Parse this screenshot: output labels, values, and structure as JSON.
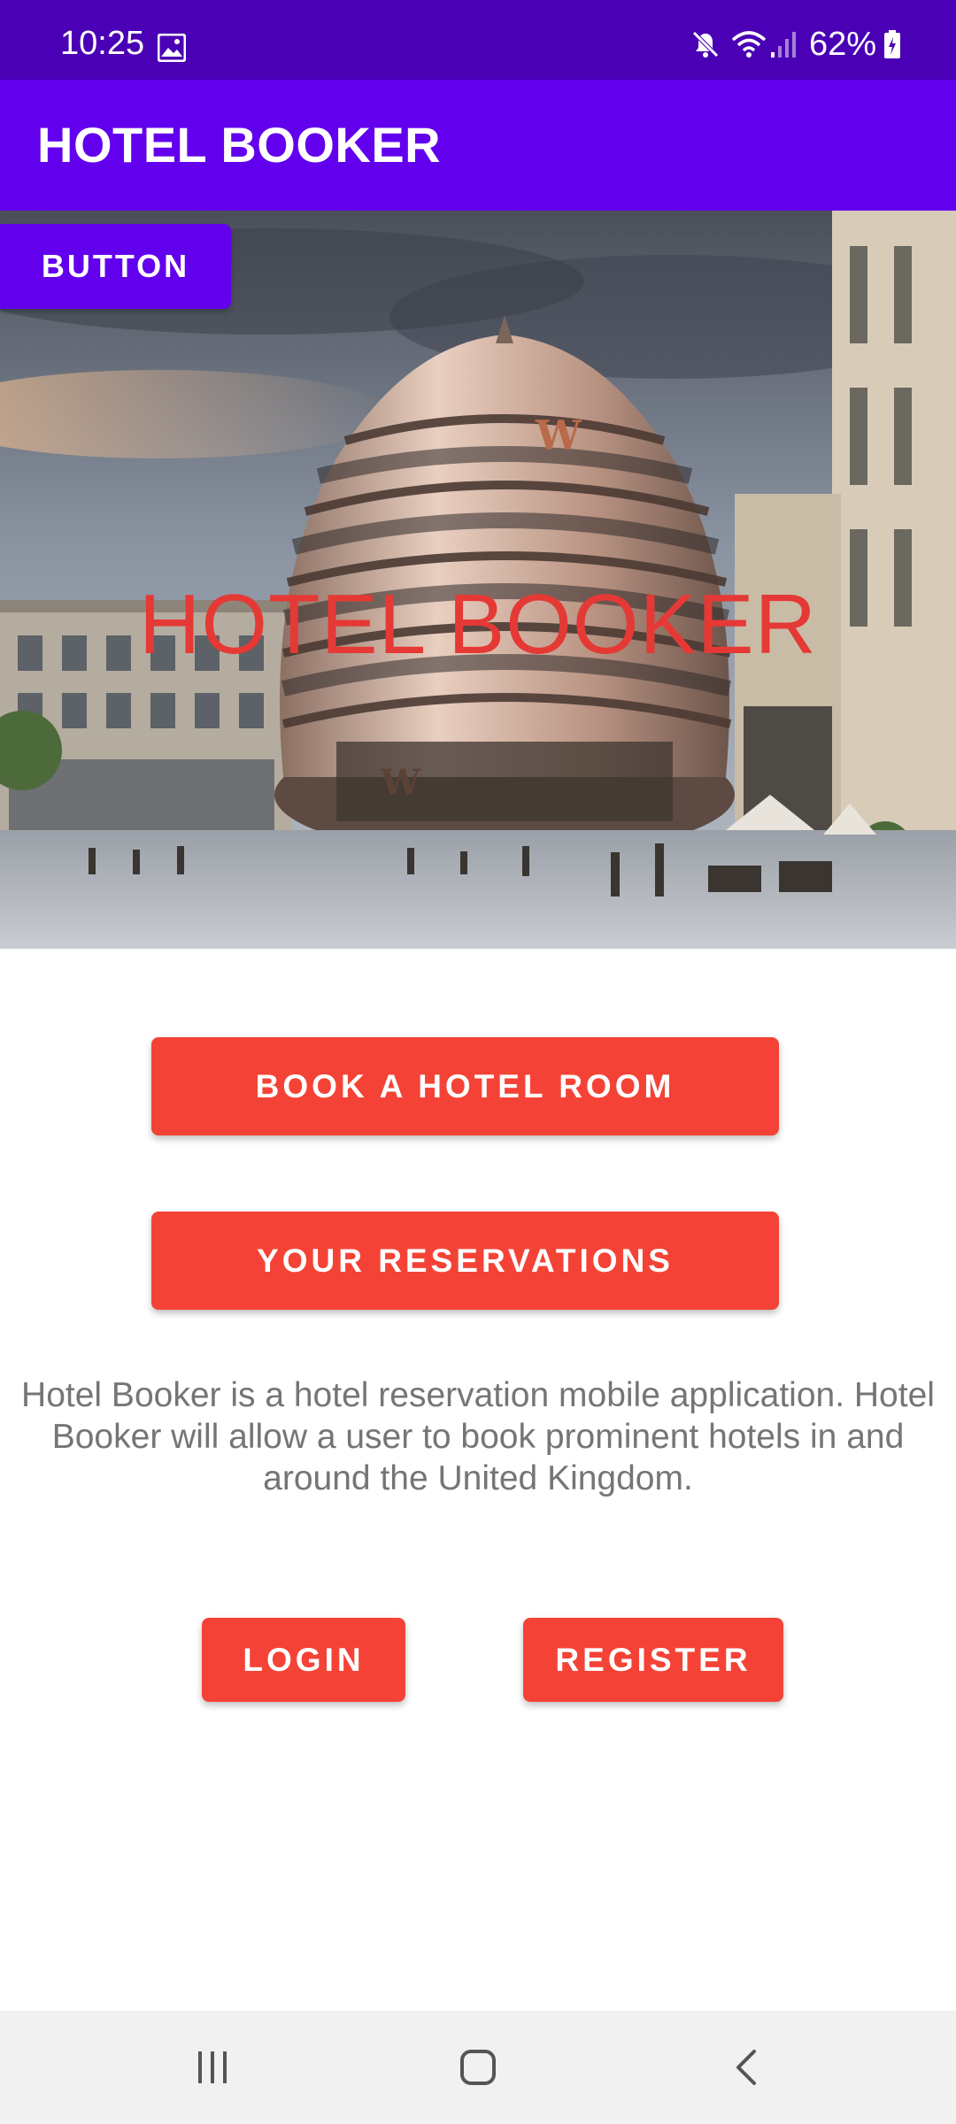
{
  "status_bar": {
    "time": "10:25",
    "battery": "62%",
    "icons": [
      "gallery-icon",
      "mute-icon",
      "wifi-icon",
      "signal-icon",
      "battery-icon"
    ]
  },
  "app_bar": {
    "title": "HOTEL BOOKER"
  },
  "hero": {
    "title": "HOTEL BOOKER",
    "button_label": "BUTTON",
    "image": "hotel-building-image"
  },
  "main": {
    "book_label": "BOOK A HOTEL ROOM",
    "reservations_label": "YOUR RESERVATIONS",
    "description": "Hotel Booker is a hotel reservation mobile application. Hotel Booker will allow a user to book prominent hotels in and around the United Kingdom.",
    "login_label": "LOGIN",
    "register_label": "REGISTER"
  },
  "nav_bar": {
    "icons": [
      "recent-apps-icon",
      "home-icon",
      "back-icon"
    ]
  },
  "colors": {
    "status_bar": "#4a00b4",
    "app_bar": "#6200ee",
    "accent_red": "#f44336",
    "hero_title": "#e53935",
    "description_text": "#757575"
  }
}
